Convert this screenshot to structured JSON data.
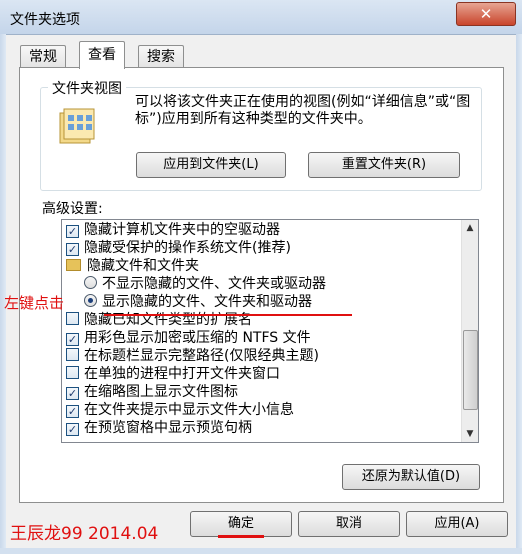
{
  "window": {
    "title": "文件夹选项",
    "close": "✕"
  },
  "tabs": [
    {
      "label": "常规"
    },
    {
      "label": "查看"
    },
    {
      "label": "搜索"
    }
  ],
  "folder_view": {
    "legend": "文件夹视图",
    "description": "可以将该文件夹正在使用的视图(例如“详细信息”或“图标”)应用到所有这种类型的文件夹中。",
    "apply_button": "应用到文件夹(L)",
    "reset_button": "重置文件夹(R)"
  },
  "advanced": {
    "label": "高级设置:",
    "items": [
      {
        "type": "checkbox",
        "checked": true,
        "label": "隐藏计算机文件夹中的空驱动器"
      },
      {
        "type": "checkbox",
        "checked": true,
        "label": "隐藏受保护的操作系统文件(推荐)"
      },
      {
        "type": "folder",
        "label": "隐藏文件和文件夹"
      },
      {
        "type": "radio",
        "checked": false,
        "label": "不显示隐藏的文件、文件夹或驱动器"
      },
      {
        "type": "radio",
        "checked": true,
        "label": "显示隐藏的文件、文件夹和驱动器"
      },
      {
        "type": "checkbox",
        "checked": false,
        "label": "隐藏已知文件类型的扩展名"
      },
      {
        "type": "checkbox",
        "checked": true,
        "label": "用彩色显示加密或压缩的 NTFS 文件"
      },
      {
        "type": "checkbox",
        "checked": false,
        "label": "在标题栏显示完整路径(仅限经典主题)"
      },
      {
        "type": "checkbox",
        "checked": false,
        "label": "在单独的进程中打开文件夹窗口"
      },
      {
        "type": "checkbox",
        "checked": true,
        "label": "在缩略图上显示文件图标"
      },
      {
        "type": "checkbox",
        "checked": true,
        "label": "在文件夹提示中显示文件大小信息"
      },
      {
        "type": "checkbox",
        "checked": true,
        "label": "在预览窗格中显示预览句柄"
      }
    ],
    "restore_button": "还原为默认值(D)"
  },
  "footer": {
    "ok": "确定",
    "cancel": "取消",
    "apply": "应用(A)"
  },
  "annotations": {
    "left_click": "左键点击",
    "watermark": "王辰龙99 2014.04"
  },
  "colors": {
    "annotation": "#e01010",
    "close": "#c9452c"
  }
}
